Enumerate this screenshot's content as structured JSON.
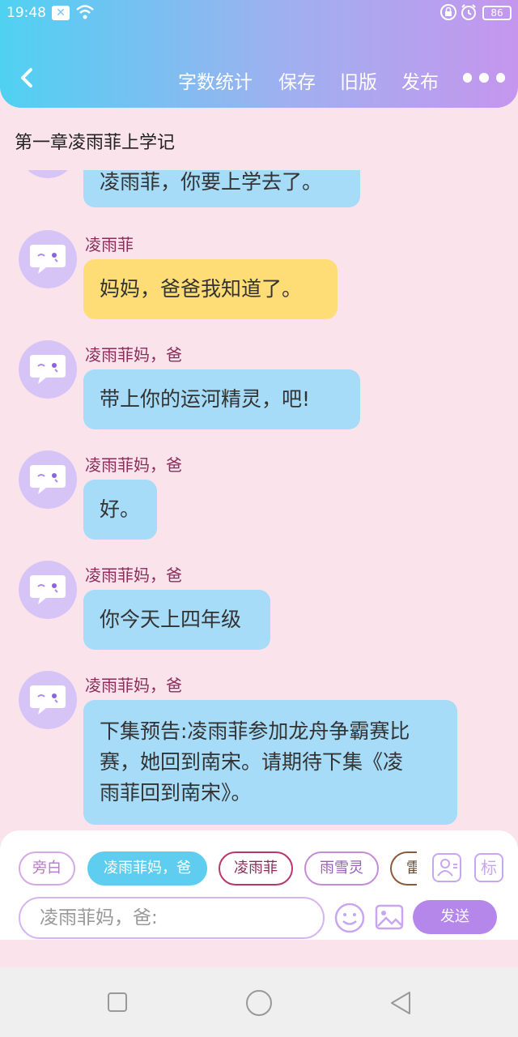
{
  "status": {
    "time": "19:48",
    "battery": "86"
  },
  "nav": {
    "items": [
      "字数统计",
      "保存",
      "旧版",
      "发布"
    ]
  },
  "chapter_title": "第一章凌雨菲上学记",
  "messages": [
    {
      "speaker": "",
      "text": "凌雨菲，你要上学去了。",
      "color": "blue"
    },
    {
      "speaker": "凌雨菲",
      "text": "妈妈，爸爸我知道了。",
      "color": "yellow"
    },
    {
      "speaker": "凌雨菲妈，爸",
      "text": "带上你的运河精灵，吧!",
      "color": "blue"
    },
    {
      "speaker": "凌雨菲妈，爸",
      "text": "好。",
      "color": "blue"
    },
    {
      "speaker": "凌雨菲妈，爸",
      "text": "你今天上四年级",
      "color": "blue"
    },
    {
      "speaker": "凌雨菲妈，爸",
      "text_lines": [
        "下集预告:凌雨菲参加龙舟争霸赛比",
        "赛，她回到南宋。请期待下集《凌",
        "雨菲回到南宋》。"
      ],
      "color": "blue"
    }
  ],
  "roles": [
    "旁白",
    "凌雨菲妈，爸",
    "凌雨菲",
    "雨雪灵",
    "雷"
  ],
  "input": {
    "placeholder": "凌雨菲妈，爸:"
  },
  "send_label": "发送",
  "mark_label": "标"
}
